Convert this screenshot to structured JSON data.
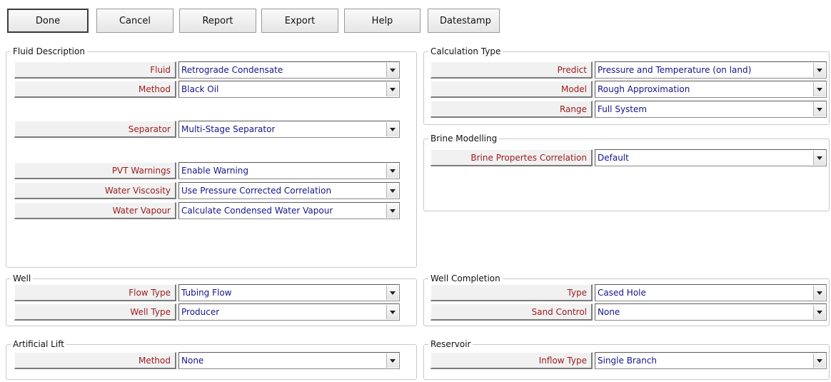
{
  "toolbar": {
    "buttons": [
      {
        "label": "Done"
      },
      {
        "label": "Cancel"
      },
      {
        "label": "Report"
      },
      {
        "label": "Export"
      },
      {
        "label": "Help"
      },
      {
        "label": "Datestamp"
      }
    ]
  },
  "fluid_description": {
    "title": "Fluid Description",
    "rows": [
      {
        "label": "Fluid",
        "value": "Retrograde Condensate"
      },
      {
        "label": "Method",
        "value": "Black Oil"
      },
      {
        "label": "Separator",
        "value": "Multi-Stage Separator"
      },
      {
        "label": "PVT Warnings",
        "value": "Enable Warning"
      },
      {
        "label": "Water Viscosity",
        "value": "Use Pressure Corrected Correlation"
      },
      {
        "label": "Water Vapour",
        "value": "Calculate Condensed Water Vapour"
      }
    ]
  },
  "calculation_type": {
    "title": "Calculation Type",
    "rows": [
      {
        "label": "Predict",
        "value": "Pressure and Temperature (on land)"
      },
      {
        "label": "Model",
        "value": "Rough Approximation"
      },
      {
        "label": "Range",
        "value": "Full System"
      }
    ]
  },
  "brine_modelling": {
    "title": "Brine Modelling",
    "rows": [
      {
        "label": "Brine Propertes Correlation",
        "value": "Default"
      }
    ]
  },
  "well": {
    "title": "Well",
    "rows": [
      {
        "label": "Flow Type",
        "value": "Tubing Flow"
      },
      {
        "label": "Well Type",
        "value": "Producer"
      }
    ]
  },
  "well_completion": {
    "title": "Well Completion",
    "rows": [
      {
        "label": "Type",
        "value": "Cased Hole"
      },
      {
        "label": "Sand Control",
        "value": "None"
      }
    ]
  },
  "artificial_lift": {
    "title": "Artificial Lift",
    "rows": [
      {
        "label": "Method",
        "value": "None"
      }
    ]
  },
  "reservoir": {
    "title": "Reservoir",
    "rows": [
      {
        "label": "Inflow Type",
        "value": "Single Branch"
      }
    ]
  }
}
